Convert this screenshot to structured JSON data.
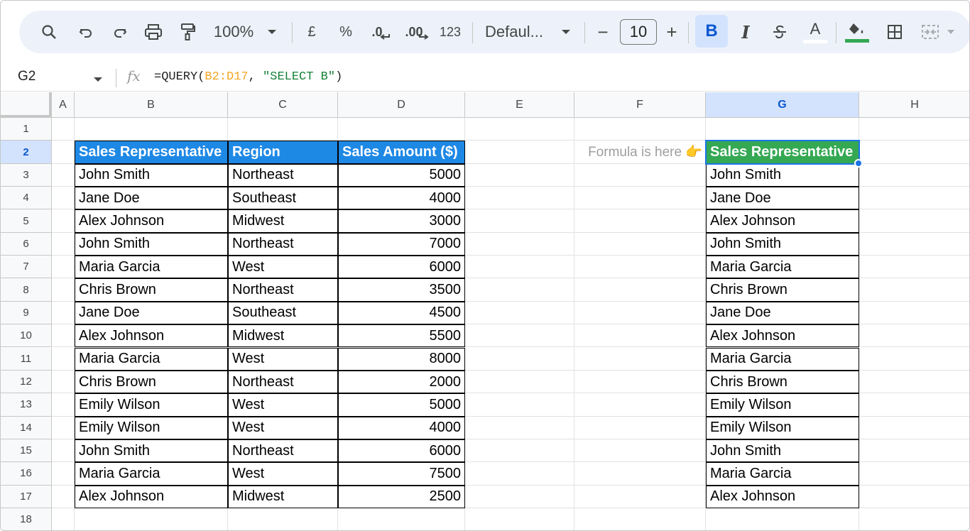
{
  "toolbar": {
    "zoom": "100%",
    "currency_label": "£",
    "percent_label": "%",
    "dec_decrease_label": ".0",
    "dec_increase_label": ".00",
    "format_label": "123",
    "font_name": "Defaul...",
    "font_size": "10",
    "minus_label": "−",
    "plus_label": "+",
    "bold_label": "B",
    "italic_label": "I",
    "text_color_label": "A",
    "text_color": "#ffffff",
    "fill_color": "#34a853"
  },
  "formula_bar": {
    "cell_ref": "G2",
    "fx_label": "fx",
    "formula_prefix": "=QUERY(",
    "formula_range": "B2:D17",
    "formula_sep": ", ",
    "formula_string": "\"SELECT B\"",
    "formula_suffix": ")"
  },
  "columns": [
    "A",
    "B",
    "C",
    "D",
    "E",
    "F",
    "G",
    "H"
  ],
  "rows": [
    "1",
    "2",
    "3",
    "4",
    "5",
    "6",
    "7",
    "8",
    "9",
    "10",
    "11",
    "12",
    "13",
    "14",
    "15",
    "16",
    "17",
    "18"
  ],
  "source_table": {
    "headers": [
      "Sales Representative",
      "Region",
      "Sales Amount ($)"
    ],
    "header_color": "#1e88e5",
    "rows": [
      [
        "John Smith",
        "Northeast",
        "5000"
      ],
      [
        "Jane Doe",
        "Southeast",
        "4000"
      ],
      [
        "Alex Johnson",
        "Midwest",
        "3000"
      ],
      [
        "John Smith",
        "Northeast",
        "7000"
      ],
      [
        "Maria Garcia",
        "West",
        "6000"
      ],
      [
        "Chris Brown",
        "Northeast",
        "3500"
      ],
      [
        "Jane Doe",
        "Southeast",
        "4500"
      ],
      [
        "Alex Johnson",
        "Midwest",
        "5500"
      ],
      [
        "Maria Garcia",
        "West",
        "8000"
      ],
      [
        "Chris Brown",
        "Northeast",
        "2000"
      ],
      [
        "Emily Wilson",
        "West",
        "5000"
      ],
      [
        "Emily Wilson",
        "West",
        "4000"
      ],
      [
        "John Smith",
        "Northeast",
        "6000"
      ],
      [
        "Maria Garcia",
        "West",
        "7500"
      ],
      [
        "Alex Johnson",
        "Midwest",
        "2500"
      ]
    ]
  },
  "note": "Formula is here 👉",
  "result_table": {
    "header": "Sales Representative",
    "header_color": "#34a853",
    "values": [
      "John Smith",
      "Jane Doe",
      "Alex Johnson",
      "John Smith",
      "Maria Garcia",
      "Chris Brown",
      "Jane Doe",
      "Alex Johnson",
      "Maria Garcia",
      "Chris Brown",
      "Emily Wilson",
      "Emily Wilson",
      "John Smith",
      "Maria Garcia",
      "Alex Johnson"
    ]
  }
}
